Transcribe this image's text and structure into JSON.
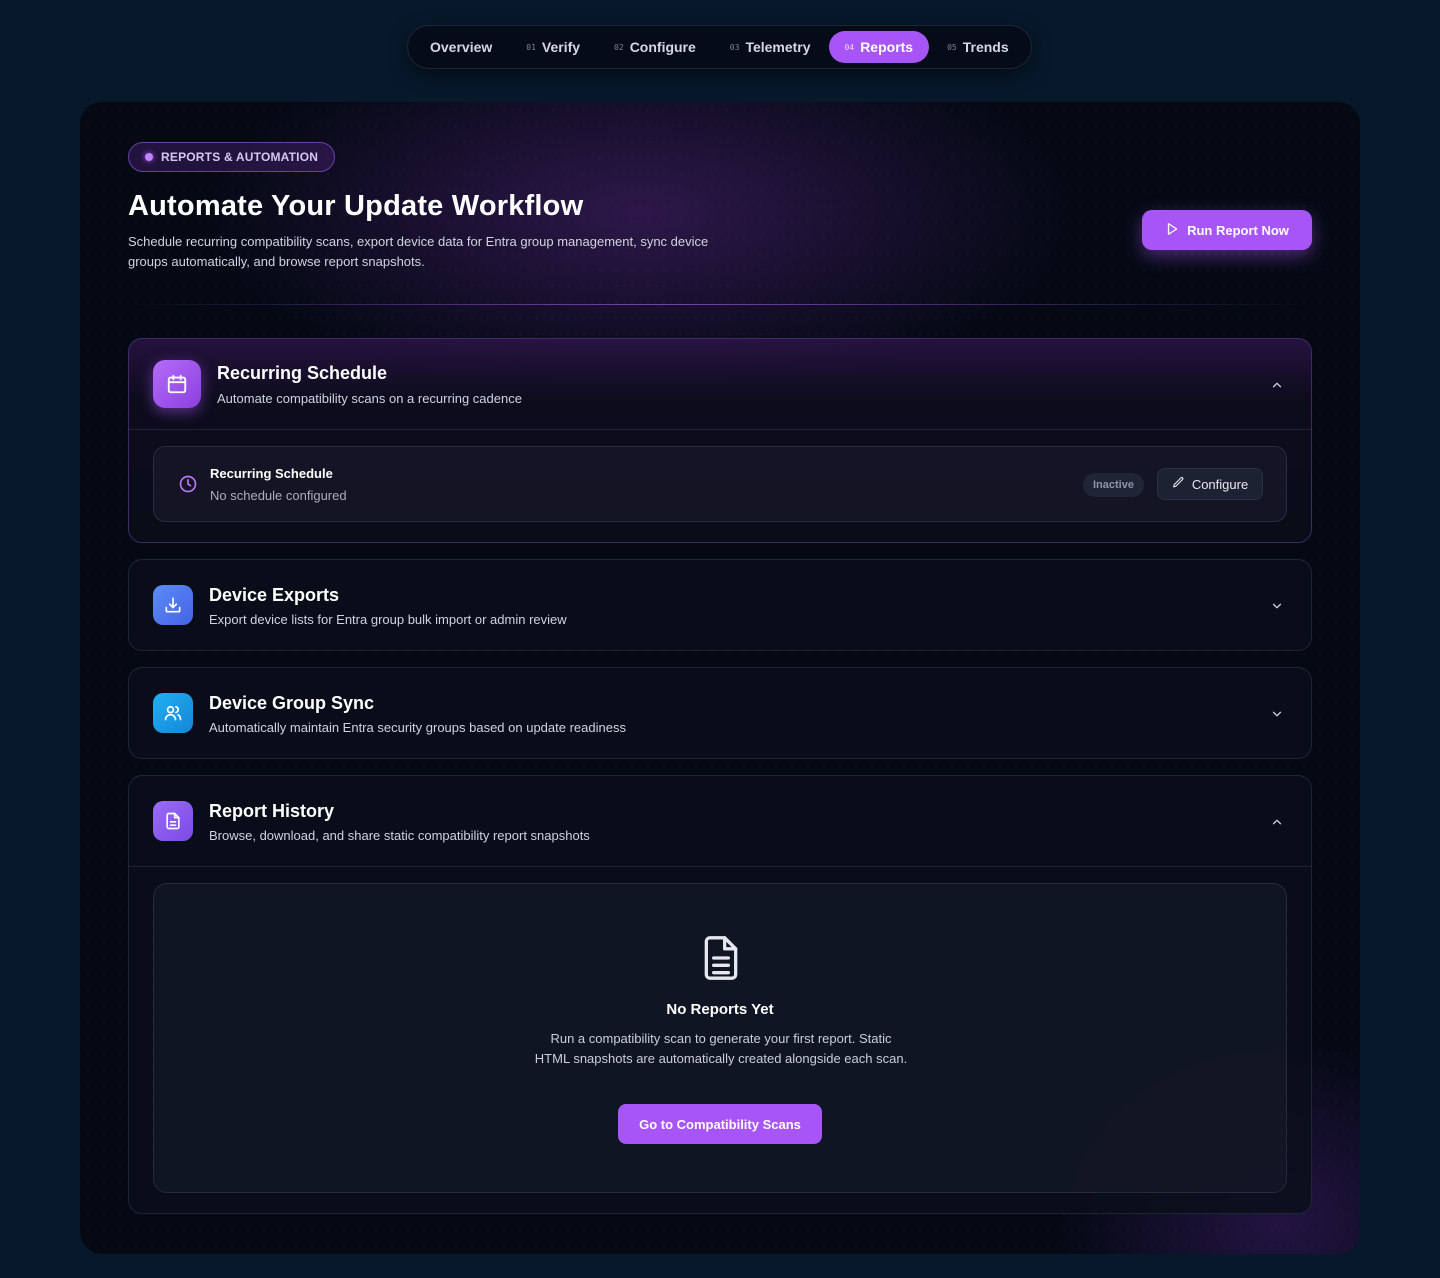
{
  "nav": {
    "tabs": [
      {
        "num": "",
        "label": "Overview"
      },
      {
        "num": "01",
        "label": "Verify"
      },
      {
        "num": "02",
        "label": "Configure"
      },
      {
        "num": "03",
        "label": "Telemetry"
      },
      {
        "num": "04",
        "label": "Reports",
        "active": true
      },
      {
        "num": "05",
        "label": "Trends"
      }
    ]
  },
  "hero": {
    "badge": "REPORTS & AUTOMATION",
    "title": "Automate Your Update Workflow",
    "subtitle": "Schedule recurring compatibility scans, export device data for Entra group management, sync device groups automatically, and browse report snapshots.",
    "run_button": "Run Report Now"
  },
  "sections": {
    "schedule": {
      "title": "Recurring Schedule",
      "desc": "Automate compatibility scans on a recurring cadence",
      "row_title": "Recurring Schedule",
      "row_sub": "No schedule configured",
      "status": "Inactive",
      "configure": "Configure"
    },
    "exports": {
      "title": "Device Exports",
      "desc": "Export device lists for Entra group bulk import or admin review"
    },
    "sync": {
      "title": "Device Group Sync",
      "desc": "Automatically maintain Entra security groups based on update readiness"
    },
    "history": {
      "title": "Report History",
      "desc": "Browse, download, and share static compatibility report snapshots",
      "empty_title": "No Reports Yet",
      "empty_text": "Run a compatibility scan to generate your first report. Static HTML snapshots are automatically created alongside each scan.",
      "empty_button": "Go to Compatibility Scans"
    }
  },
  "colors": {
    "accent": "#a855f7",
    "background": "#07182a",
    "panel": "#050914",
    "exports_icon": "#4f7cf0",
    "sync_icon": "#1aa0e8",
    "history_icon": "#8b5cf6"
  },
  "icons": {
    "schedule": "calendar-icon",
    "exports": "download-icon",
    "sync": "users-icon",
    "history": "file-text-icon",
    "row": "clock-icon",
    "configure": "pencil-icon",
    "run": "play-icon"
  }
}
